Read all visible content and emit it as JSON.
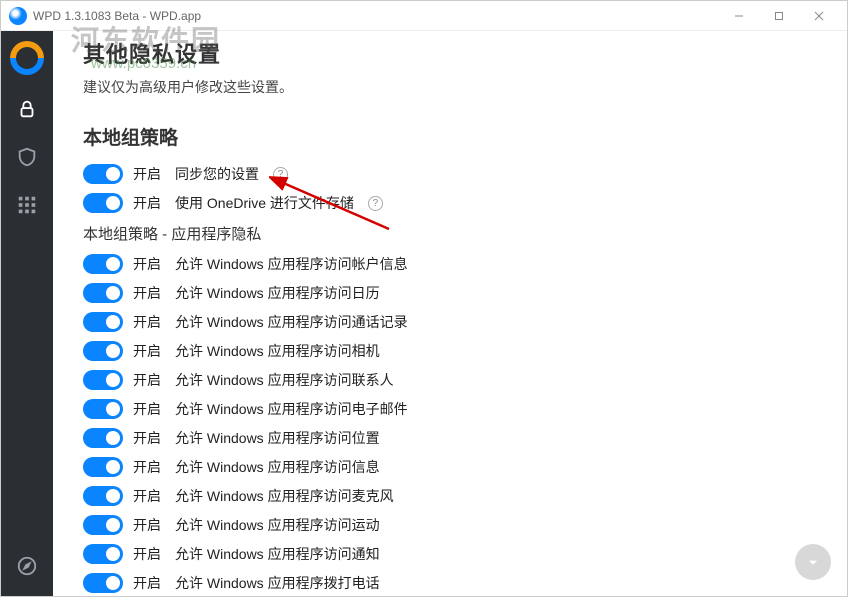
{
  "window": {
    "title": "WPD 1.3.1083 Beta  -  WPD.app"
  },
  "watermark": {
    "text": "河东软件园",
    "url": "www.pc0359.cn"
  },
  "page": {
    "heading": "其他隐私设置",
    "subtitle": "建议仅为高级用户修改这些设置。"
  },
  "section_group_policy": {
    "title": "本地组策略",
    "items": [
      {
        "state": "开启",
        "label": "同步您的设置",
        "help": true
      },
      {
        "state": "开启",
        "label": "使用 OneDrive 进行文件存储",
        "help": true
      }
    ],
    "sub_title": "本地组策略 - 应用程序隐私",
    "sub_items": [
      {
        "state": "开启",
        "label": "允许 Windows 应用程序访问帐户信息"
      },
      {
        "state": "开启",
        "label": "允许 Windows 应用程序访问日历"
      },
      {
        "state": "开启",
        "label": "允许 Windows 应用程序访问通话记录"
      },
      {
        "state": "开启",
        "label": "允许 Windows 应用程序访问相机"
      },
      {
        "state": "开启",
        "label": "允许 Windows 应用程序访问联系人"
      },
      {
        "state": "开启",
        "label": "允许 Windows 应用程序访问电子邮件"
      },
      {
        "state": "开启",
        "label": "允许 Windows 应用程序访问位置"
      },
      {
        "state": "开启",
        "label": "允许 Windows 应用程序访问信息"
      },
      {
        "state": "开启",
        "label": "允许 Windows 应用程序访问麦克风"
      },
      {
        "state": "开启",
        "label": "允许 Windows 应用程序访问运动"
      },
      {
        "state": "开启",
        "label": "允许 Windows 应用程序访问通知"
      },
      {
        "state": "开启",
        "label": "允许 Windows 应用程序拨打电话"
      }
    ]
  },
  "help_glyph": "?"
}
